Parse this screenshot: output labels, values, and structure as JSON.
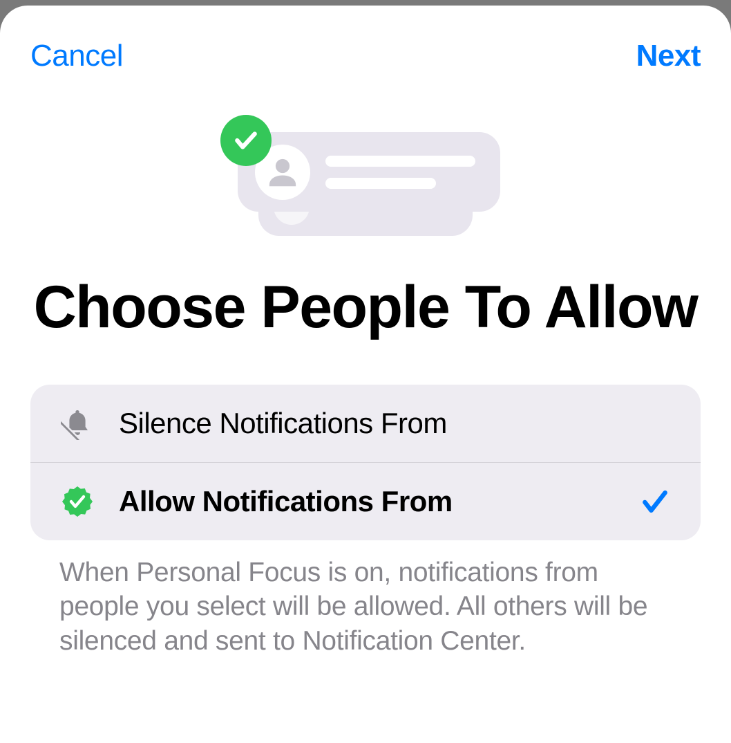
{
  "nav": {
    "cancel_label": "Cancel",
    "next_label": "Next"
  },
  "hero": {
    "title": "Choose People To Allow"
  },
  "options": {
    "silence": {
      "label": "Silence Notifications From",
      "selected": false
    },
    "allow": {
      "label": "Allow Notifications From",
      "selected": true
    }
  },
  "footer": {
    "text": "When Personal Focus is on, notifications from people you select will be allowed. All others will be silenced and sent to Notification Center."
  },
  "colors": {
    "accent": "#007AFF",
    "success": "#34C759"
  }
}
